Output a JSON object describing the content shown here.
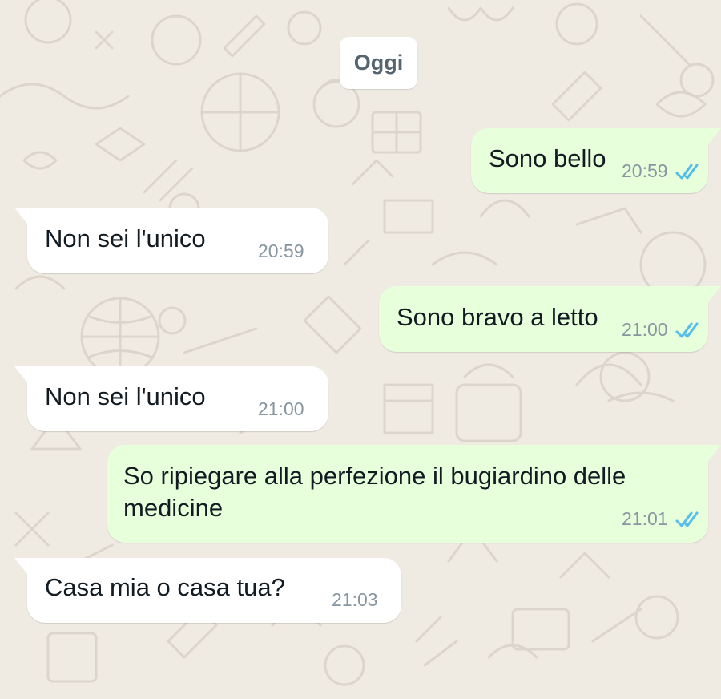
{
  "date_label": "Oggi",
  "colors": {
    "background": "#efeae2",
    "incoming_bubble": "#ffffff",
    "outgoing_bubble": "#e7ffdb",
    "read_ticks": "#53bdeb"
  },
  "messages": [
    {
      "direction": "out",
      "text": "Sono bello",
      "time": "20:59",
      "status": "read"
    },
    {
      "direction": "in",
      "text": "Non sei l'unico",
      "time": "20:59"
    },
    {
      "direction": "out",
      "text": "Sono bravo a letto",
      "time": "21:00",
      "status": "read"
    },
    {
      "direction": "in",
      "text": "Non sei l'unico",
      "time": "21:00"
    },
    {
      "direction": "out",
      "text": "So ripiegare alla perfezione il bugiardino delle\nmedicine",
      "time": "21:01",
      "status": "read"
    },
    {
      "direction": "in",
      "text": "Casa mia o casa tua?",
      "time": "21:03"
    }
  ],
  "icons": {
    "read_receipt": "double-check-icon"
  }
}
